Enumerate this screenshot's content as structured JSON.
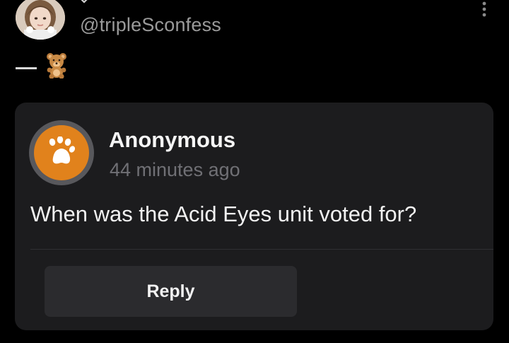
{
  "header": {
    "handle": "@tripleSconfess",
    "avatar_icon": "profile-photo",
    "chevron_icon": "chevron-down-icon",
    "more_icon": "more-vertical-icon"
  },
  "post": {
    "prefix_icon": "teddy-bear-emoji"
  },
  "card": {
    "sender": "Anonymous",
    "time": "44 minutes ago",
    "avatar_icon": "paw-icon",
    "avatar_color": "#e1821c",
    "question": "When was the Acid Eyes unit voted for?",
    "reply_label": "Reply"
  }
}
